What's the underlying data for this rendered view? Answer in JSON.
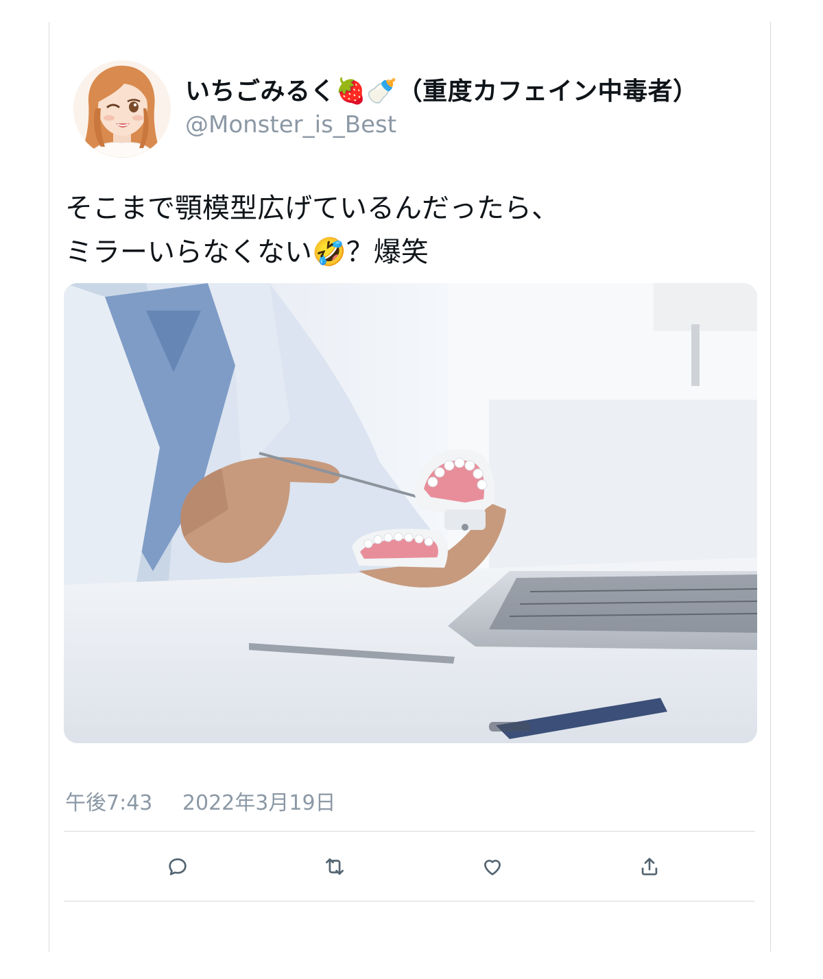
{
  "tweet": {
    "display_name": "いちごみるく🍓🍼（重度カフェイン中毒者）",
    "handle": "@Monster_is_Best",
    "text_lines": [
      "そこまで顎模型広げているんだったら、",
      "ミラーいらなくない🤣？爆笑"
    ],
    "time": "午後7:43",
    "date": "2022年3月19日"
  },
  "media": {
    "avatar": "illustrated-woman-avatar",
    "photo": "dentist-holding-denture-model-photo"
  },
  "actions": [
    {
      "name": "reply-icon"
    },
    {
      "name": "retweet-icon"
    },
    {
      "name": "like-icon"
    },
    {
      "name": "share-icon"
    }
  ],
  "colors": {
    "text_primary": "#0f1419",
    "text_secondary": "#8b98a5",
    "icon": "#536471",
    "divider": "#d6d9db"
  }
}
